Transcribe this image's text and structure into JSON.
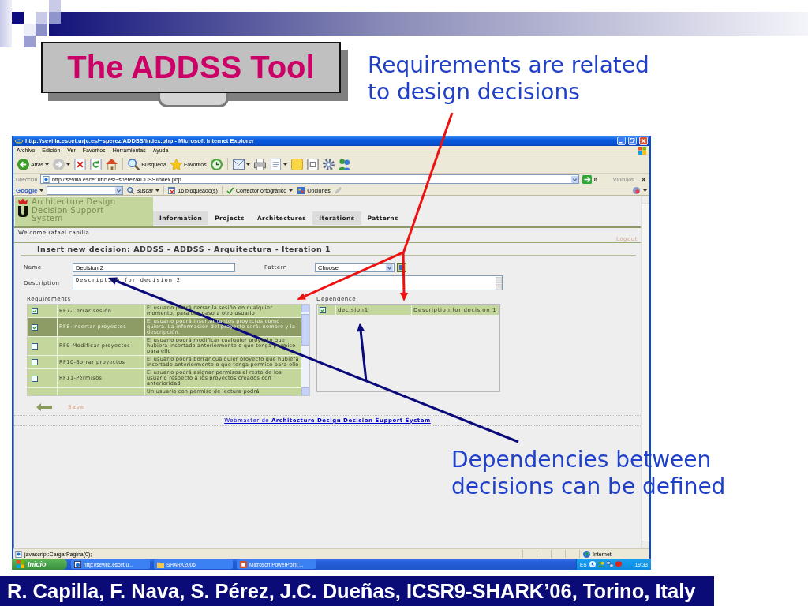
{
  "slide": {
    "title": "The ADDSS Tool",
    "callouts": [
      "Requirements are related to design decisions",
      "Dependencies between decisions can be defined"
    ],
    "footer": "R. Capilla, F. Nava, S. Pérez, J.C. Dueñas, ICSR9-SHARK’06, Torino, Italy"
  },
  "browser": {
    "title": "http://sevilla.escet.urjc.es/~sperez/ADDSS/index.php - Microsoft Internet Explorer",
    "menu": [
      "Archivo",
      "Edición",
      "Ver",
      "Favoritos",
      "Herramientas",
      "Ayuda"
    ],
    "toolbar": [
      {
        "kind": "back",
        "label": "Atrás",
        "dropdown": true
      },
      {
        "kind": "forward",
        "dropdown": true
      },
      {
        "kind": "stop",
        "dropdown": false
      },
      {
        "kind": "refresh",
        "dropdown": false
      },
      {
        "kind": "home",
        "dropdown": false
      },
      {
        "kind": "separator"
      },
      {
        "kind": "search",
        "label": "Búsqueda",
        "dropdown": false
      },
      {
        "kind": "favorites",
        "label": "Favoritos",
        "dropdown": false
      },
      {
        "kind": "history",
        "dropdown": false
      },
      {
        "kind": "separator"
      },
      {
        "kind": "mail",
        "dropdown": true
      },
      {
        "kind": "print",
        "dropdown": false
      },
      {
        "kind": "edit",
        "dropdown": true
      },
      {
        "kind": "note",
        "dropdown": false
      },
      {
        "kind": "window",
        "dropdown": false
      },
      {
        "kind": "gear",
        "dropdown": false
      },
      {
        "kind": "people",
        "dropdown": false
      }
    ],
    "address": {
      "label": "Dirección",
      "value": "http://sevilla.escet.urjc.es/~sperez/ADDSS/index.php",
      "go": "Ir",
      "links": "Vínculos",
      "more": "»"
    },
    "google": {
      "logo": "Google",
      "search_button": "Buscar",
      "blocked": "16 bloqueado(s)",
      "spellcheck": "Corrector ortográfico",
      "options": "Opciones"
    },
    "status": {
      "text": "javascript:CargarPagina(0);",
      "zone": "Internet"
    }
  },
  "page": {
    "logo_lines": [
      "Architecture Design",
      "Decision Support",
      "System"
    ],
    "nav": [
      {
        "label": "Information",
        "selected": true
      },
      {
        "label": "Projects",
        "selected": false
      },
      {
        "label": "Architectures",
        "selected": false
      },
      {
        "label": "Iterations",
        "selected": true
      },
      {
        "label": "Patterns",
        "selected": false
      }
    ],
    "welcome": "Welcome rafael capilla",
    "logout": "Logout",
    "heading": "Insert new decision: ADDSS - ADDSS - Arquitectura - Iteration 1",
    "form": {
      "name_label": "Name",
      "name": "Decision 2",
      "pattern_label": "Pattern",
      "pattern": "Choose",
      "description_label": "Description",
      "description": "Description for decision 2"
    },
    "requirements": {
      "label": "Requirements",
      "rows": [
        {
          "kind": "requirement",
          "checked": true,
          "selected": false,
          "id": "RF7-Cerrar sesión",
          "description": "El usuario podrá cerrar la sesión en cualquier momento, para dar paso a otro usuario"
        },
        {
          "kind": "requirement",
          "checked": true,
          "selected": true,
          "id": "RF8-Insertar proyectos",
          "description": "El usuario podrá insertar tantos proyectos como quiera. La información del proyecto será: nombre y la descripción."
        },
        {
          "kind": "requirement",
          "checked": false,
          "selected": false,
          "id": "RF9-Modificar proyectos",
          "description": "El usuario podrá modificar cualquier proyecto que hubiera insertado anteriormente o que tenga permiso para ello"
        },
        {
          "kind": "requirement",
          "checked": false,
          "selected": false,
          "id": "RF10-Borrar proyectos",
          "description": "El usuario podrá borrar cualquier proyecto que hubiera insertado anteriormente o que tenga permiso para ello"
        },
        {
          "kind": "requirement",
          "checked": false,
          "selected": false,
          "id": "RF11-Permisos",
          "description": "El usuario podrá asignar permisos al resto de los usuario respecto a los proyectos creados con anterioridad"
        },
        {
          "kind": "cut_off",
          "description": "Un usuario con permiso de lectura podrá"
        }
      ]
    },
    "dependence": {
      "label": "Dependence",
      "rows": [
        {
          "checked": true,
          "name": "decision1",
          "description": "Description for decision 1"
        }
      ]
    },
    "save": "Save",
    "footer": "Webmaster de **Architecture Design Decision Support System**"
  },
  "taskbar": {
    "start": "Inicio",
    "tasks": [
      {
        "kind": "browser",
        "label": "http://sevilla.escet.u..."
      },
      {
        "kind": "folder",
        "label": "SHARK2006"
      },
      {
        "kind": "slides",
        "label": "Microsoft PowerPoint ..."
      }
    ],
    "language": "ES",
    "clock": "19:33"
  }
}
